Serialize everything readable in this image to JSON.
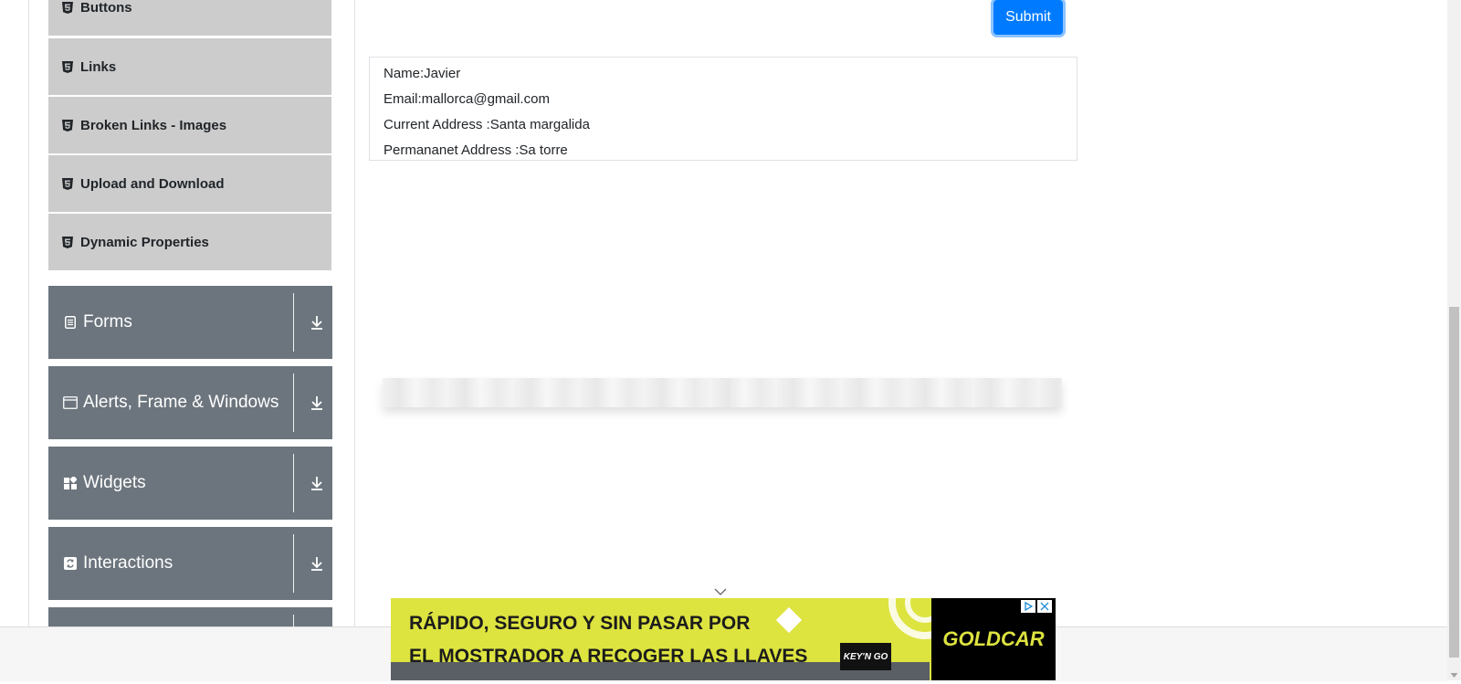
{
  "sidebar": {
    "elements_items": [
      {
        "label": "Buttons",
        "icon": "html5-icon"
      },
      {
        "label": "Links",
        "icon": "html5-icon"
      },
      {
        "label": "Broken Links - Images",
        "icon": "html5-icon"
      },
      {
        "label": "Upload and Download",
        "icon": "html5-icon"
      },
      {
        "label": "Dynamic Properties",
        "icon": "html5-icon"
      }
    ],
    "groups": [
      {
        "label": "Forms",
        "icon": "form-icon"
      },
      {
        "label": "Alerts, Frame & Windows",
        "icon": "window-icon"
      },
      {
        "label": "Widgets",
        "icon": "widgets-icon"
      },
      {
        "label": "Interactions",
        "icon": "interactions-icon"
      },
      {
        "label": "",
        "icon": ""
      }
    ]
  },
  "form": {
    "submit_label": "Submit",
    "output": {
      "name": "Name:Javier",
      "email": "Email:mallorca@gmail.com",
      "current_address": "Current Address :Santa margalida",
      "permanent_address": "Permananet Address :Sa torre"
    }
  },
  "ad": {
    "line1": "RÁPIDO, SEGURO Y SIN PASAR POR",
    "line2": "EL MOSTRADOR A RECOGER LAS LLAVES",
    "badge": "KEY'N GO",
    "brand": "GOLDCAR",
    "colors": {
      "background": "#dde33f",
      "brand_bg": "#000000"
    }
  },
  "colors": {
    "accent": "#007bff",
    "group_bg": "#6c757d",
    "item_bg": "#cccccc"
  }
}
